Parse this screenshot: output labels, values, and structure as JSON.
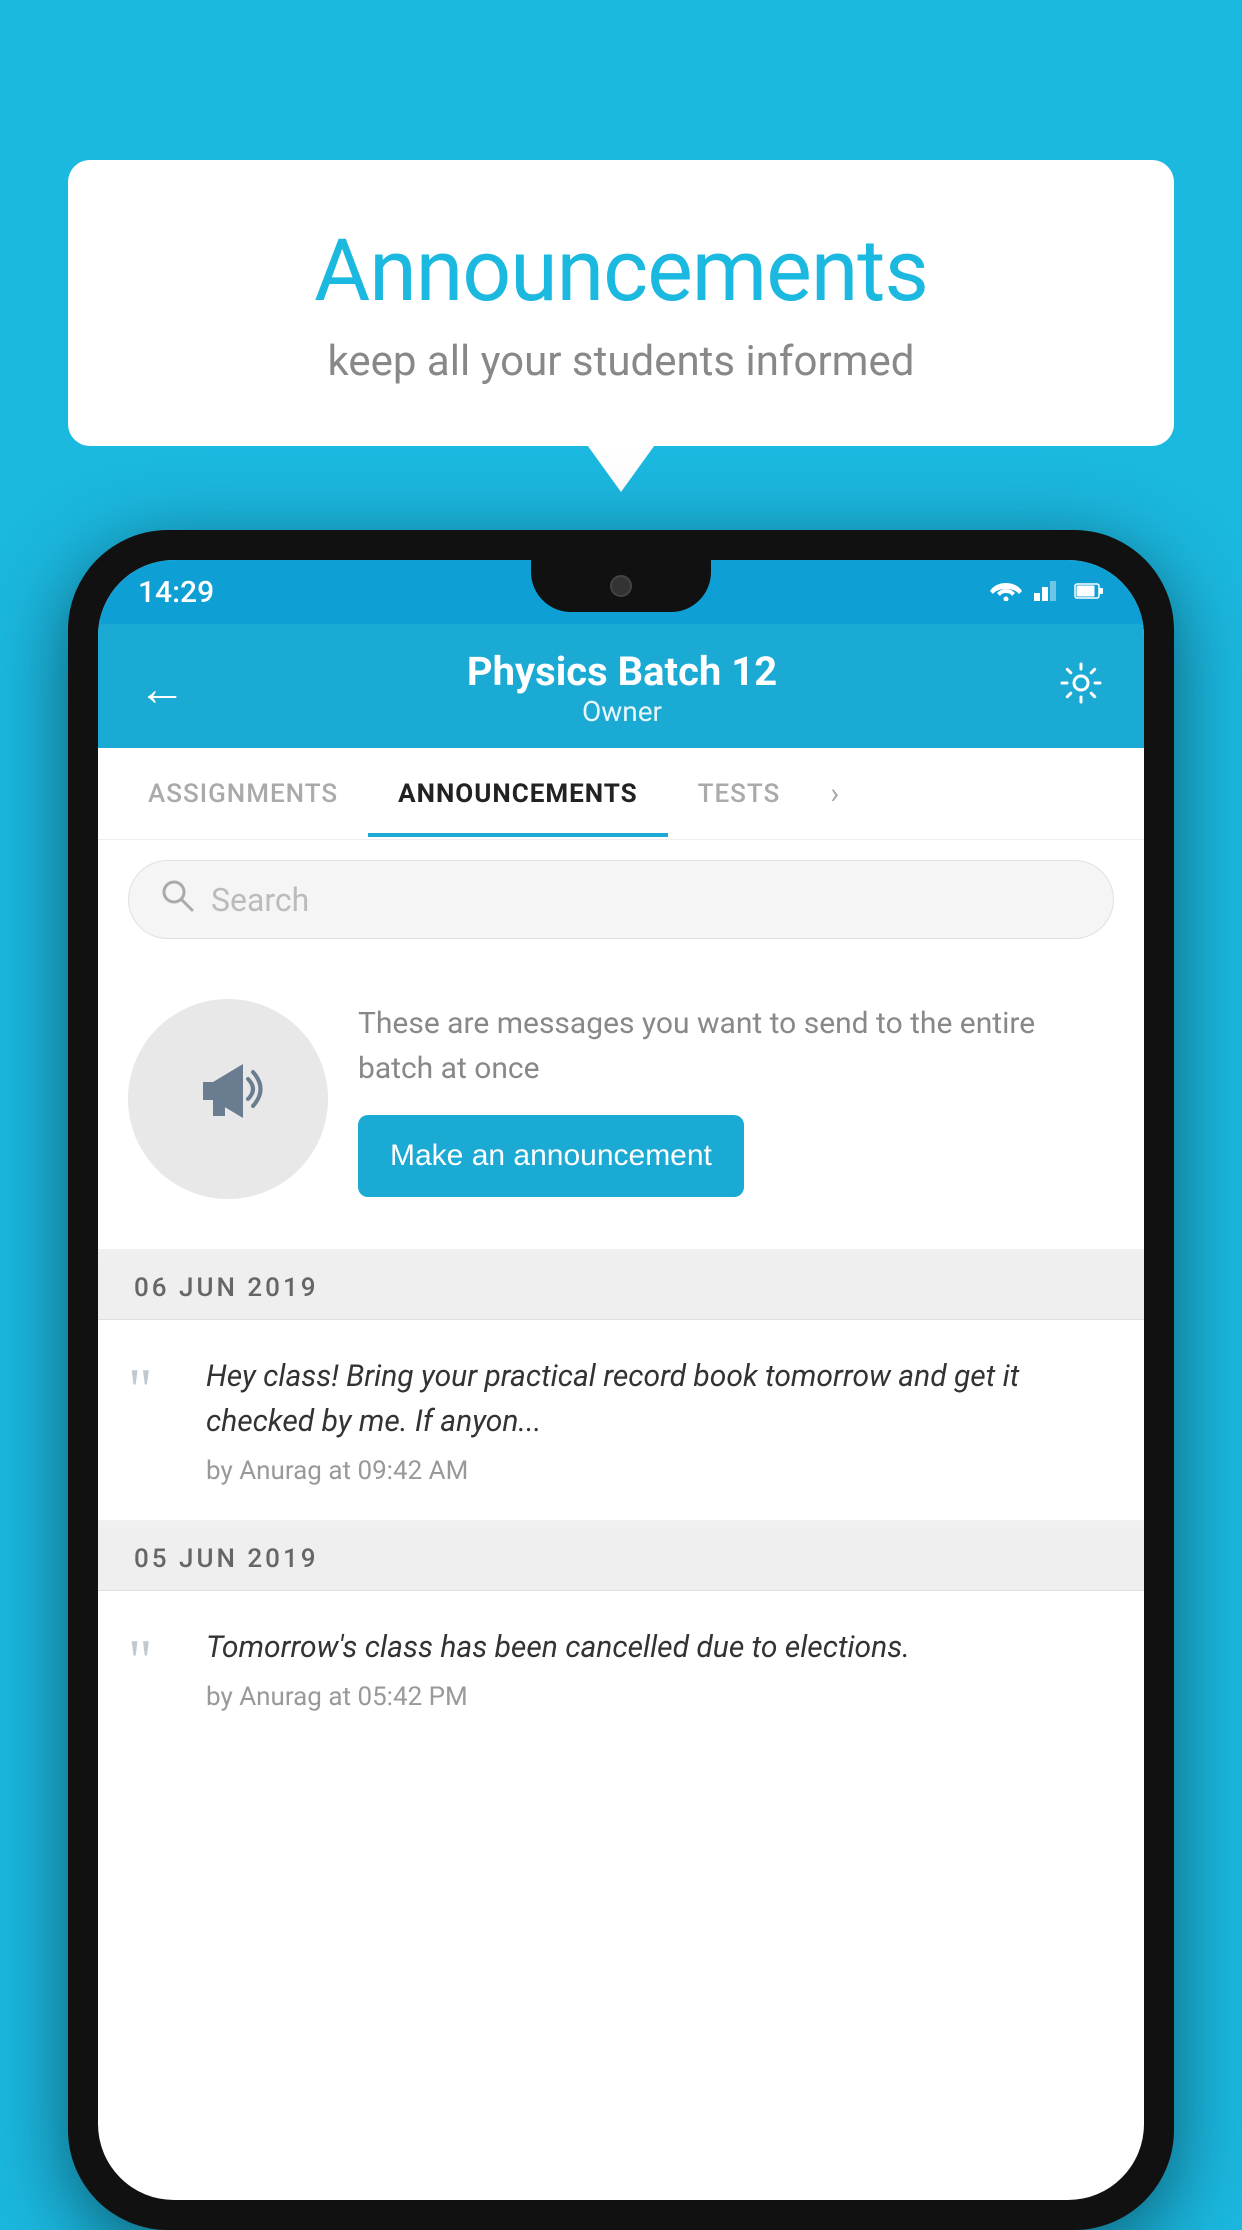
{
  "background_color": "#1bb8e0",
  "speech_bubble": {
    "title": "Announcements",
    "subtitle": "keep all your students informed"
  },
  "phone": {
    "status_bar": {
      "time": "14:29",
      "wifi": "▼",
      "signal": "▲",
      "battery": "▮"
    },
    "header": {
      "title": "Physics Batch 12",
      "subtitle": "Owner",
      "back_label": "←",
      "gear_label": "⚙"
    },
    "tabs": [
      {
        "label": "ASSIGNMENTS",
        "active": false
      },
      {
        "label": "ANNOUNCEMENTS",
        "active": true
      },
      {
        "label": "TESTS",
        "active": false
      }
    ],
    "search": {
      "placeholder": "Search"
    },
    "promo": {
      "description": "These are messages you want to send to the entire batch at once",
      "button_label": "Make an announcement"
    },
    "announcements": [
      {
        "date": "06  JUN  2019",
        "text": "Hey class! Bring your practical record book tomorrow and get it checked by me. If anyon...",
        "meta": "by Anurag at 09:42 AM"
      },
      {
        "date": "05  JUN  2019",
        "text": "Tomorrow's class has been cancelled due to elections.",
        "meta": "by Anurag at 05:42 PM"
      }
    ]
  }
}
